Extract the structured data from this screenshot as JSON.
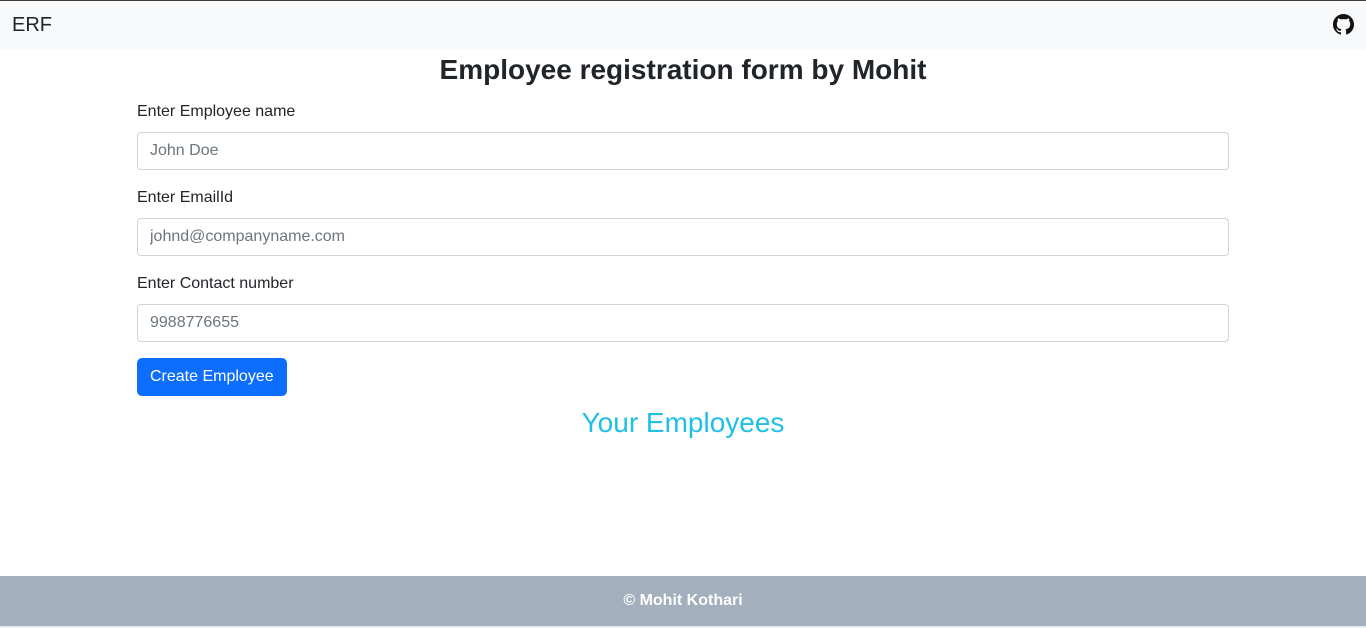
{
  "navbar": {
    "brand": "ERF",
    "github_icon": "github-icon"
  },
  "page": {
    "title": "Employee registration form by Mohit"
  },
  "form": {
    "name_label": "Enter Employee name",
    "name_placeholder": "John Doe",
    "email_label": "Enter EmailId",
    "email_placeholder": "johnd@companyname.com",
    "contact_label": "Enter Contact number",
    "contact_placeholder": "9988776655",
    "submit_label": "Create Employee"
  },
  "employees": {
    "heading": "Your Employees",
    "heading_color": "#1fbfe6"
  },
  "footer": {
    "text": "© Mohit Kothari"
  },
  "colors": {
    "primary": "#0d6efd",
    "navbar_bg": "#f8f9fa",
    "footer_bg": "#a3afbd"
  }
}
